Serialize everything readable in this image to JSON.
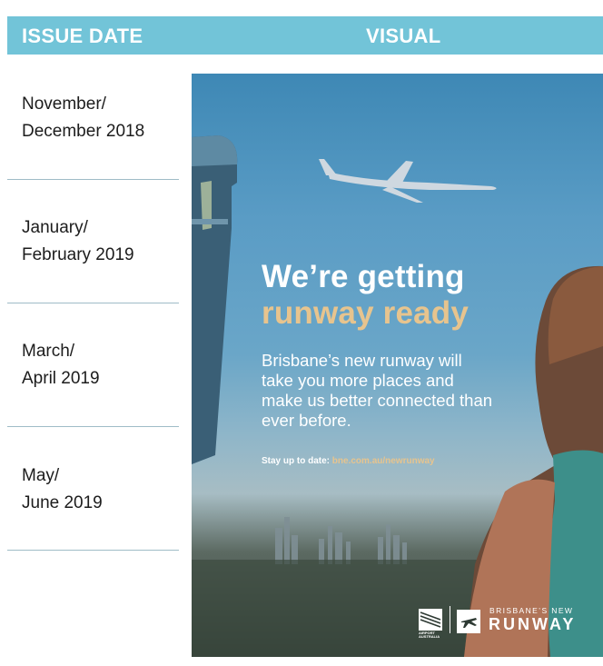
{
  "header": {
    "issue_date_label": "ISSUE DATE",
    "visual_label": "VISUAL",
    "background_color": "#72c4d8"
  },
  "issues": [
    {
      "line1": "November/",
      "line2": "December 2018"
    },
    {
      "line1": "January/",
      "line2": "February 2019"
    },
    {
      "line1": "March/",
      "line2": "April 2019"
    },
    {
      "line1": "May/",
      "line2": "June 2019"
    }
  ],
  "ad": {
    "headline_line1": "We’re getting",
    "headline_line2": "runway ready",
    "body": "Brisbane’s new runway will take you more places and make us better connected than ever before.",
    "cta_label": "Stay up to date:",
    "cta_url": "bne.com.au/newrunway",
    "accent_color": "#e7c48e",
    "logo_airport": "BRISBANE AIRPORT AUSTRALIA",
    "logo_subtitle": "BRISBANE’S NEW",
    "logo_title": "RUNWAY",
    "icons": [
      "airport-logo-icon",
      "airplane-icon"
    ]
  }
}
